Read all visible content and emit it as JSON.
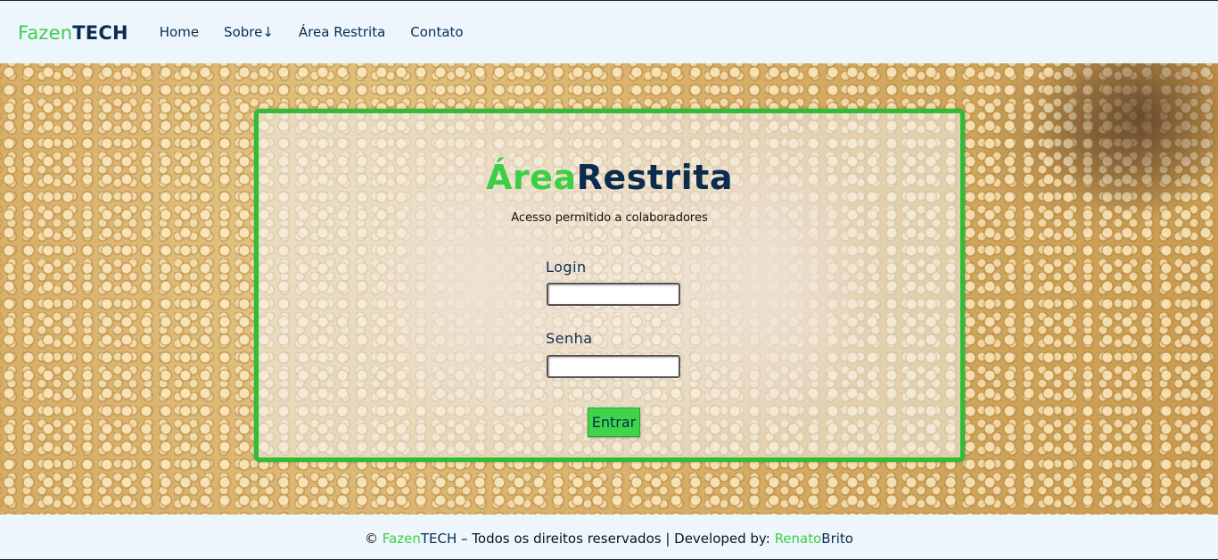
{
  "header": {
    "logo_part1": "Fazen",
    "logo_part2": "TECH",
    "nav": [
      {
        "label": "Home"
      },
      {
        "label": "Sobre↓"
      },
      {
        "label": "Área Restrita"
      },
      {
        "label": "Contato"
      }
    ]
  },
  "login": {
    "title_part1": "Área",
    "title_part2": "Restrita",
    "subtitle": "Acesso permitido a colaboradores",
    "login_label": "Login",
    "login_value": "",
    "password_label": "Senha",
    "password_value": "",
    "submit_label": "Entrar"
  },
  "footer": {
    "copyright_symbol": "©",
    "brand_part1": "Fazen",
    "brand_part2": "TECH",
    "rights_text": "– Todos os direitos reservados | Developed by:",
    "dev_part1": "Renato",
    "dev_part2": "Brito"
  },
  "colors": {
    "accent_green": "#3ccf45",
    "navy": "#0b2c4f",
    "header_bg": "#eef6fd",
    "card_border": "#2ebd34"
  }
}
